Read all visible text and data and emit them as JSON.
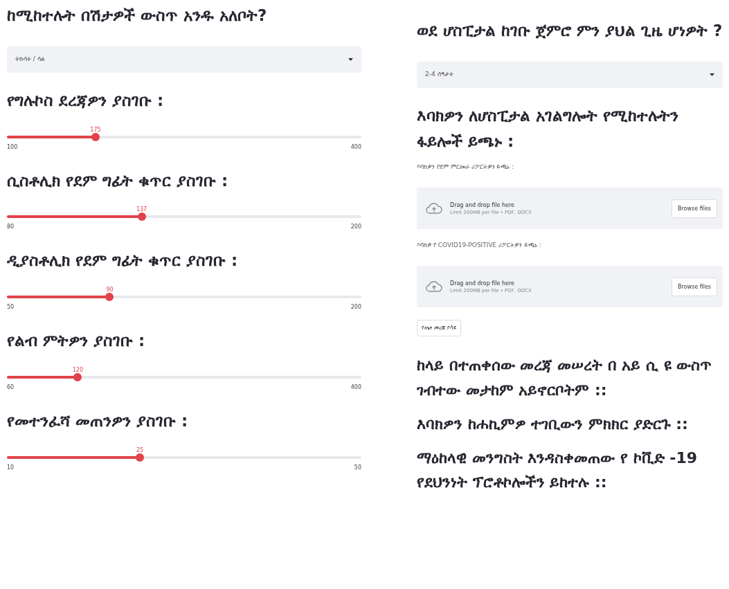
{
  "left": [
    {
      "kind": "select",
      "label": "ከሚከተሉት በሽታዎች ውስጥ አንዱ አለቦት?",
      "value": "ትኩሳት / ሳል"
    },
    {
      "kind": "slider",
      "label": "የግሉኮስ ደረጃዎን ያስገቡ :",
      "value": "175",
      "min": "100",
      "max": "400",
      "level": 0.25
    },
    {
      "kind": "slider",
      "label": "ሲስቶሊክ የደም ግፊት ቁጥር ያስገቡ :",
      "value": "137",
      "min": "80",
      "max": "200",
      "level": 0.38
    },
    {
      "kind": "slider",
      "label": "ዲያስቶሊክ የደም ግፊት ቁጥር ያስገቡ :",
      "value": "90",
      "min": "50",
      "max": "200",
      "level": 0.29
    },
    {
      "kind": "slider",
      "label": "የልብ ምትዎን ያስገቡ :",
      "value": "120",
      "min": "60",
      "max": "400",
      "level": 0.2
    },
    {
      "kind": "slider",
      "label": "የመተንፈሻ መጠንዎን ያስገቡ :",
      "value": "25",
      "min": "10",
      "max": "50",
      "level": 0.375
    }
  ],
  "right": [
    {
      "kind": "select",
      "label": "ወደ ሆስፒታል ከገቡ ጀምሮ ምን ያህል ጊዜ ሆነዎት ?",
      "value": "2-4 ሰዓታት"
    },
    {
      "kind": "heading",
      "text": "እባክዎን ለሆስፒታል አገልግሎት የሚከተሉትን ፋይሎች ይጫኑ :"
    },
    {
      "kind": "upload",
      "label": "እባክዎን የደም ምርመራ ሪፖርትዎን ይጫኑ :",
      "prompt": "Drag and drop file here",
      "limit": "Limit 200MB per file • PDF, DOCX",
      "button": "Browse files"
    },
    {
      "kind": "upload",
      "label": "እባክዎ የ COVID19-POSITIVE ሪፖርትዎን ይጫኑ :",
      "prompt": "Drag and drop file here",
      "limit": "Limit 200MB per file • PDF, DOCX",
      "button": "Browse files"
    },
    {
      "kind": "button",
      "text": "የጤና መረጃ ያሳዩ"
    },
    {
      "kind": "result",
      "text": "ከላይ በተጠቀሰው መረጃ መሠረት በ አይ ሲ ዩ ውስጥ ገብተው መታከም አይኖርቦትም ::"
    },
    {
      "kind": "result",
      "text": "እባክዎን ከሐኪምዎ ተገቢውን ምክክር ያድርጉ ::"
    },
    {
      "kind": "result",
      "text": "ማዕከላዊ መንግስት እንዳስቀመጠው የ ኮቪድ -19 የደህንነት ፕሮቶኮሎችን ይከተሉ ::"
    }
  ]
}
